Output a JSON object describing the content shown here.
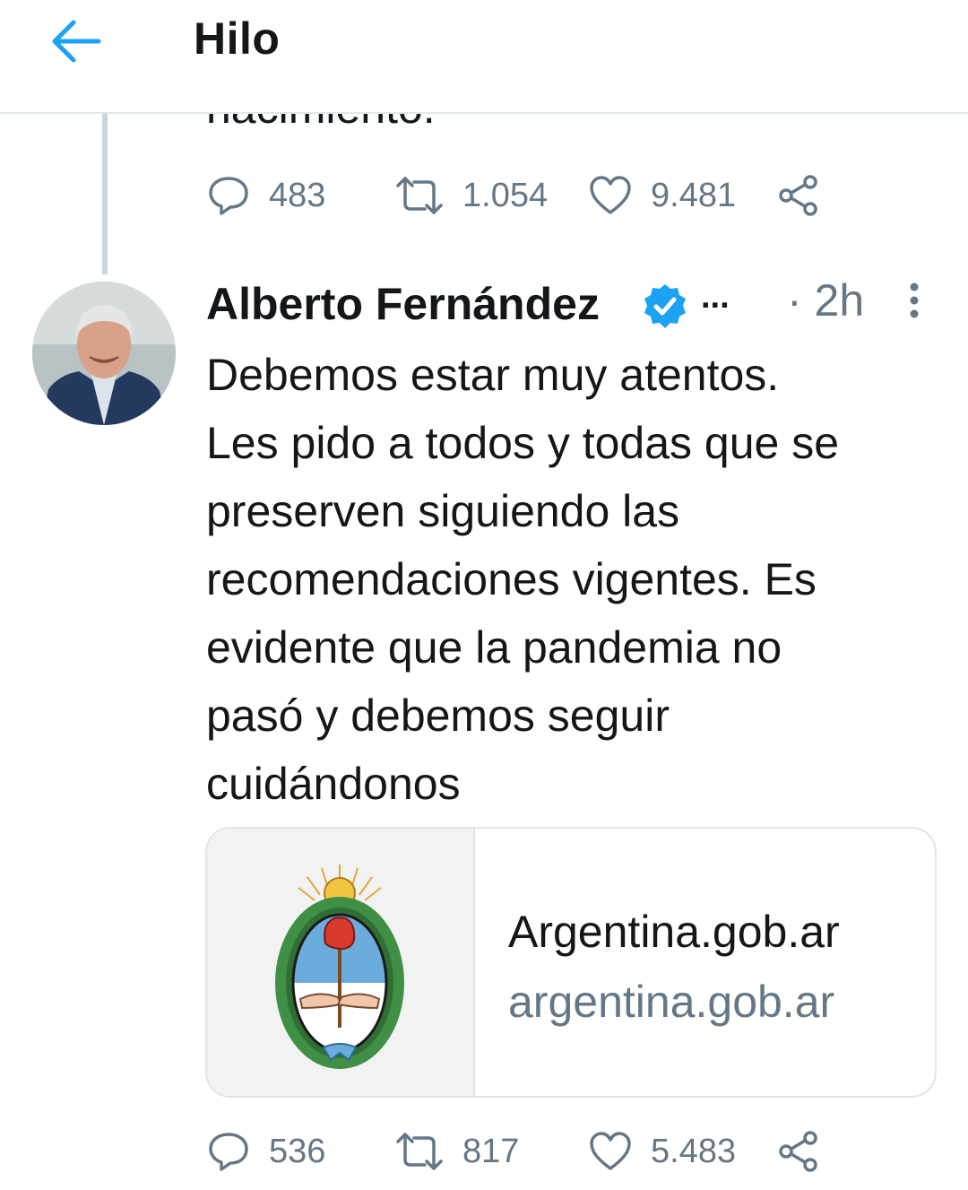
{
  "header": {
    "title": "Hilo",
    "back_icon": "arrow-left-icon"
  },
  "previous_tweet": {
    "partial_text": "nacimiento.",
    "actions": {
      "replies": "483",
      "retweets": "1.054",
      "likes": "9.481"
    }
  },
  "tweet": {
    "author_name": "Alberto Fernández",
    "ellipsis": "...",
    "timestamp": "· 2h",
    "text": "Debemos estar muy atentos.\nLes pido a todos y todas que se\npreserven siguiendo las\nrecomendaciones vigentes. Es\nevidente que la pandemia no\npasó y debemos seguir\ncuidándonos",
    "card": {
      "title": "Argentina.gob.ar",
      "domain": "argentina.gob.ar"
    },
    "actions": {
      "replies": "536",
      "retweets": "817",
      "likes": "5.483"
    }
  },
  "colors": {
    "accent": "#1da1f2",
    "text": "#14171a",
    "muted": "#657786",
    "border": "#e1e8ed"
  }
}
